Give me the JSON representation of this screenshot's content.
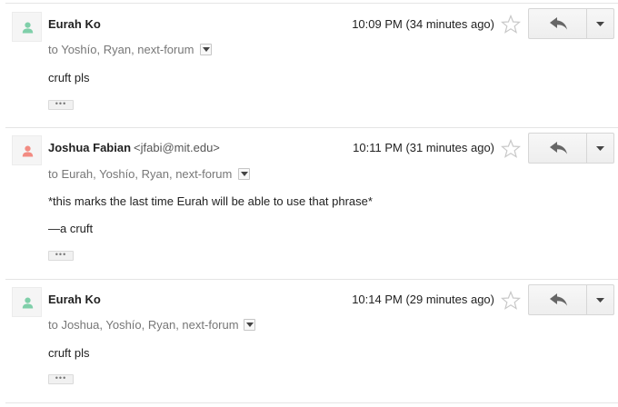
{
  "messages": [
    {
      "sender_name": "Eurah Ko",
      "sender_email": "",
      "avatar_color": "#7fcfa9",
      "recipients": "to Yoshío, Ryan, next-forum",
      "time": "10:09 PM (34 minutes ago)",
      "body": [
        "cruft pls"
      ],
      "show_trimmed": "•••"
    },
    {
      "sender_name": "Joshua Fabian",
      "sender_email": "<jfabi@mit.edu>",
      "avatar_color": "#f28b82",
      "recipients": "to Eurah, Yoshío, Ryan, next-forum",
      "time": "10:11 PM (31 minutes ago)",
      "body": [
        "*this marks the last time Eurah will be able to use that phrase*",
        "—a cruft"
      ],
      "show_trimmed": "•••"
    },
    {
      "sender_name": "Eurah Ko",
      "sender_email": "",
      "avatar_color": "#7fcfa9",
      "recipients": "to Joshua, Yoshío, Ryan, next-forum",
      "time": "10:14 PM (29 minutes ago)",
      "body": [
        "cruft pls"
      ],
      "show_trimmed": "•••"
    }
  ],
  "icons": {
    "avatar": "person-icon",
    "star": "star-icon",
    "reply": "reply-arrow-icon",
    "more": "dropdown-caret-icon",
    "recipients_toggle": "chevron-down-icon"
  }
}
